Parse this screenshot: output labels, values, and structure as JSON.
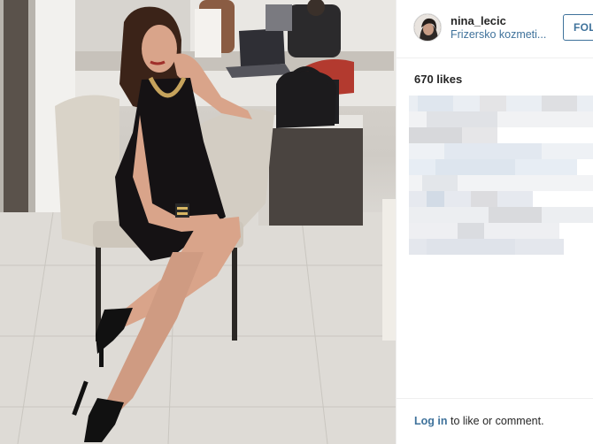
{
  "post": {
    "username": "nina_lecic",
    "location": "Frizersko kozmeti...",
    "follow_label": "FOLLOW",
    "likes": "670 likes",
    "login_link": "Log in",
    "login_suffix": " to like or comment."
  },
  "colors": {
    "link": "#3f729b",
    "text": "#262626",
    "border": "#efefef"
  },
  "icons": {
    "avatar": "profile-photo"
  }
}
